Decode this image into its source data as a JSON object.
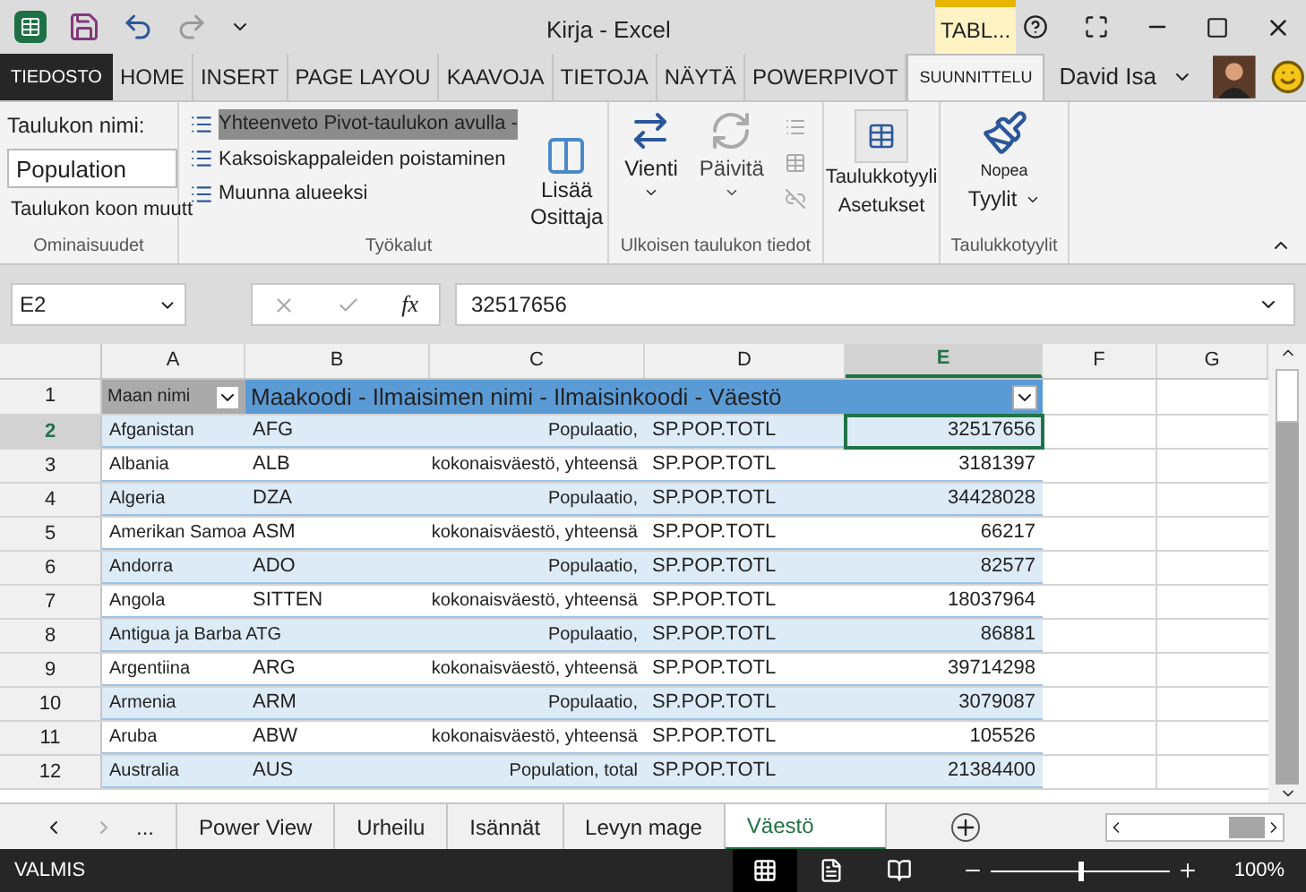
{
  "window": {
    "title": "Kirja - Excel",
    "context_tab": "TABL..."
  },
  "ribbon_tabs": [
    {
      "label": "TIEDOSTO",
      "kind": "file",
      "selected": false
    },
    {
      "label": "HOME",
      "kind": "tab",
      "selected": false
    },
    {
      "label": "INSERT",
      "kind": "tab",
      "selected": false
    },
    {
      "label": "PAGE LAYOU",
      "kind": "tab",
      "selected": false
    },
    {
      "label": "KAAVOJA",
      "kind": "tab",
      "selected": false
    },
    {
      "label": "TIETOJA",
      "kind": "tab",
      "selected": false
    },
    {
      "label": "NÄYTÄ",
      "kind": "tab",
      "selected": false
    },
    {
      "label": "POWERPIVOT",
      "kind": "tab",
      "selected": false
    },
    {
      "label": "SUUNNITTELU",
      "kind": "tab",
      "selected": true
    }
  ],
  "user": {
    "name": "David Isa"
  },
  "ribbon": {
    "properties": {
      "name_label": "Taulukon nimi:",
      "name_value": "Population",
      "resize": "Taulukon koon muutt",
      "group": "Ominaisuudet"
    },
    "tools": {
      "items": [
        {
          "label": "Yhteenveto Pivot-taulukon avulla -",
          "selected": true
        },
        {
          "label": "Kaksoiskappaleiden poistaminen",
          "selected": false
        },
        {
          "label": "Muunna alueeksi",
          "selected": false
        }
      ],
      "slicer": [
        "Lisää",
        "Osittaja"
      ],
      "group": "Työkalut"
    },
    "external": {
      "export": "Vienti",
      "refresh": "Päivitä",
      "group": "Ulkoisen taulukon tiedot"
    },
    "style_options": [
      "Taulukkotyyli",
      "Asetukset"
    ],
    "styles": {
      "quick": [
        "Nopea",
        "Tyylit"
      ],
      "group": "Taulukkotyylit"
    }
  },
  "formula_bar": {
    "name_box": "E2",
    "function_label": "fx",
    "value": "32517656"
  },
  "columns": [
    {
      "label": "A",
      "selected": false
    },
    {
      "label": "B",
      "selected": false
    },
    {
      "label": "C",
      "selected": false
    },
    {
      "label": "D",
      "selected": false
    },
    {
      "label": "E",
      "selected": true
    },
    {
      "label": "F",
      "selected": false
    },
    {
      "label": "G",
      "selected": false
    }
  ],
  "table_header": {
    "row": "1",
    "first": "Maan nimi",
    "rest": "Maakoodi - Ilmaisimen nimi - Ilmaisinkoodi - Väestö"
  },
  "rows": [
    {
      "num": "2",
      "selected": true,
      "cells": [
        "Afganistan",
        "AFG",
        "Populaatio,",
        "SP.POP.TOTL",
        "32517656"
      ]
    },
    {
      "num": "3",
      "selected": false,
      "cells": [
        "Albania",
        "ALB",
        "kokonaisväestö, yhteensä",
        "SP.POP.TOTL",
        "3181397"
      ]
    },
    {
      "num": "4",
      "selected": false,
      "cells": [
        "Algeria",
        "DZA",
        "Populaatio,",
        "SP.POP.TOTL",
        "34428028"
      ]
    },
    {
      "num": "5",
      "selected": false,
      "cells": [
        "Amerikan Samoa",
        "ASM",
        "kokonaisväestö, yhteensä",
        "SP.POP.TOTL",
        "66217"
      ]
    },
    {
      "num": "6",
      "selected": false,
      "cells": [
        "Andorra",
        "ADO",
        "Populaatio,",
        "SP.POP.TOTL",
        "82577"
      ]
    },
    {
      "num": "7",
      "selected": false,
      "cells": [
        "Angola",
        "SITTEN",
        "kokonaisväestö, yhteensä",
        "SP.POP.TOTL",
        "18037964"
      ]
    },
    {
      "num": "8",
      "selected": false,
      "cells": [
        "Antigua ja Barba ATG",
        "",
        "Populaatio,",
        "SP.POP.TOTL",
        "86881"
      ]
    },
    {
      "num": "9",
      "selected": false,
      "cells": [
        "Argentiina",
        "ARG",
        "kokonaisväestö, yhteensä",
        "SP.POP.TOTL",
        "39714298"
      ]
    },
    {
      "num": "10",
      "selected": false,
      "cells": [
        "Armenia",
        "ARM",
        "Populaatio,",
        "SP.POP.TOTL",
        "3079087"
      ]
    },
    {
      "num": "11",
      "selected": false,
      "cells": [
        "Aruba",
        "ABW",
        "kokonaisväestö, yhteensä",
        "SP.POP.TOTL",
        "105526"
      ]
    },
    {
      "num": "12",
      "selected": false,
      "cells": [
        "Australia",
        "AUS",
        "Population, total",
        "SP.POP.TOTL",
        "21384400"
      ]
    }
  ],
  "sheet_tabs": [
    {
      "label": "...",
      "selected": false
    },
    {
      "label": "Power View",
      "selected": false
    },
    {
      "label": "Urheilu",
      "selected": false
    },
    {
      "label": "Isännät",
      "selected": false
    },
    {
      "label": "Levyn mage",
      "selected": false
    },
    {
      "label": "Väestö",
      "selected": true
    }
  ],
  "status_bar": {
    "status": "VALMIS",
    "zoom": "100%",
    "zoom_slider": {
      "level": 0.5
    }
  }
}
